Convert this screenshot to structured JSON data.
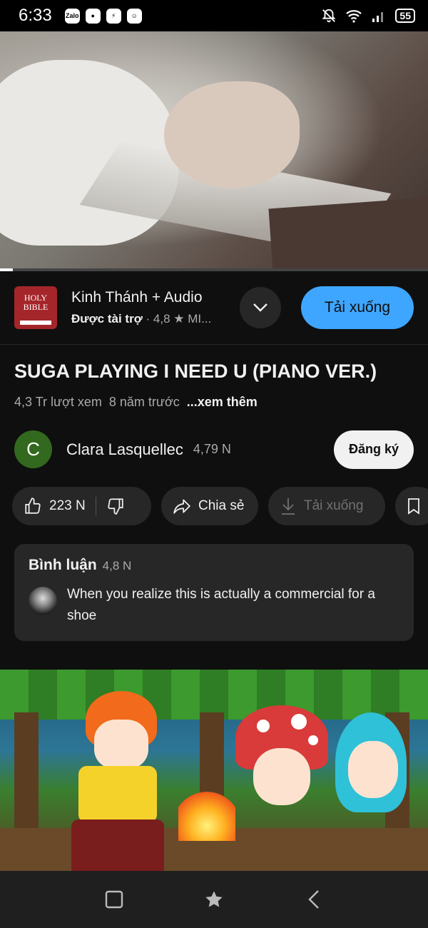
{
  "status_bar": {
    "time": "6:33",
    "notifications": [
      "Zalo",
      "Messenger-bubble",
      "Messenger",
      "Discord-like"
    ],
    "battery": "55"
  },
  "video": {
    "progress_fraction": 0.03
  },
  "ad": {
    "logo_text": "HOLY BIBLE",
    "title": "Kinh Thánh + Audio",
    "sponsored": "Được tài trợ",
    "rating": "4,8",
    "extra": "MI...",
    "cta": "Tải xuống"
  },
  "video_info": {
    "title": "SUGA PLAYING I NEED U (PIANO VER.)",
    "views": "4,3 Tr lượt xem",
    "age": "8 năm trước",
    "more": "...xem thêm"
  },
  "channel": {
    "avatar_letter": "C",
    "name": "Clara Lasquellec",
    "subscribers": "4,79 N",
    "subscribe_label": "Đăng ký"
  },
  "actions": {
    "likes": "223 N",
    "share": "Chia sẻ",
    "download": "Tải xuống"
  },
  "comments": {
    "title": "Bình luận",
    "count": "4,8 N",
    "top_comment": "When you realize this is actually a commercial for a shoe"
  },
  "colors": {
    "background": "#0f0f0f",
    "chip": "#272727",
    "accent_blue": "#3ea6ff",
    "channel_avatar": "#33691e"
  }
}
